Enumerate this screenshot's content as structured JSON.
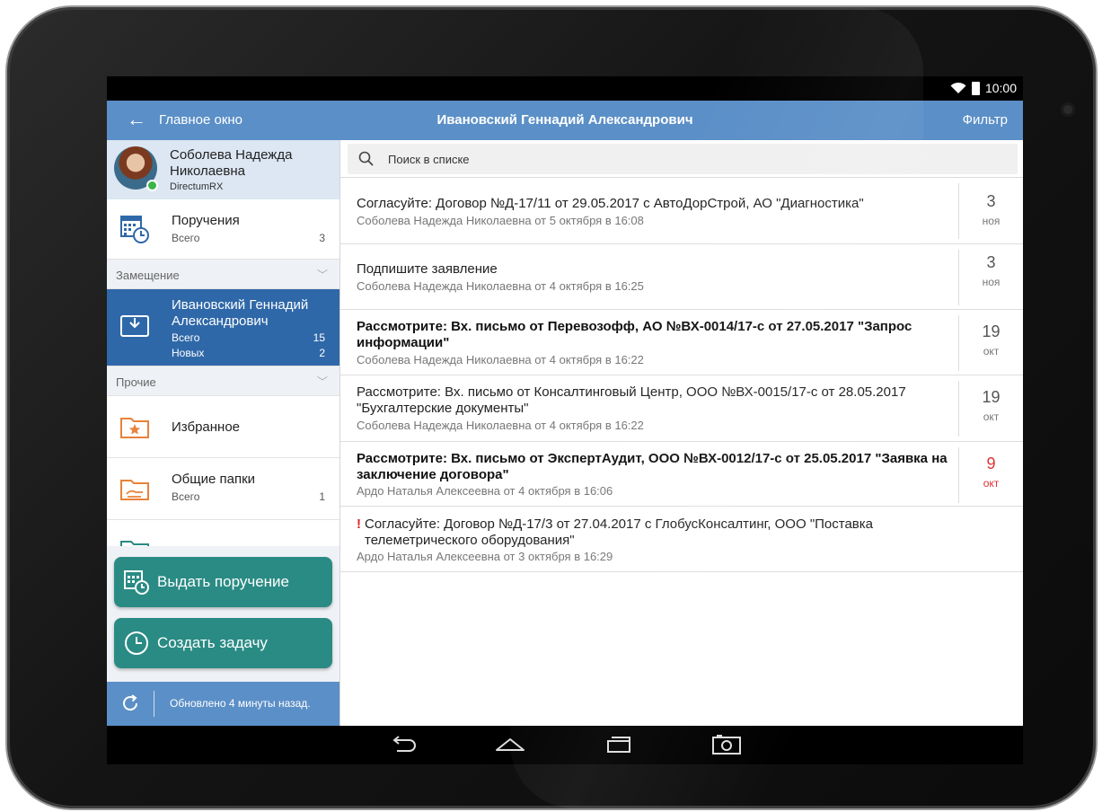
{
  "status_bar": {
    "time": "10:00"
  },
  "app_bar": {
    "back_label": "Главное окно",
    "title": "Ивановский Геннадий Александрович",
    "filter_label": "Фильтр"
  },
  "profile": {
    "name": "Соболева Надежда Николаевна",
    "org": "DirectumRX"
  },
  "sidebar": {
    "assignments": {
      "label": "Поручения",
      "sub": "Всего",
      "count": "3"
    },
    "substitution_section": "Замещение",
    "substitute": {
      "label": "Ивановский Геннадий Александрович",
      "total_label": "Всего",
      "total": "15",
      "new_label": "Новых",
      "new": "2"
    },
    "other_section": "Прочие",
    "favorites": {
      "label": "Избранное"
    },
    "shared_folders": {
      "label": "Общие папки",
      "sub": "Всего",
      "count": "1"
    }
  },
  "actions": {
    "issue_assignment": "Выдать поручение",
    "create_task": "Создать задачу"
  },
  "sync": {
    "text": "Обновлено 4 минуты назад."
  },
  "search": {
    "placeholder": "Поиск в списке"
  },
  "tasks": [
    {
      "title": "Согласуйте: Договор №Д-17/11 от 29.05.2017 с АвтоДорСтрой, АО \"Диагностика\"",
      "meta": "Соболева Надежда Николаевна от 5 октября в 16:08",
      "day": "3",
      "month": "ноя"
    },
    {
      "title": "Подпишите заявление",
      "meta": "Соболева Надежда Николаевна от 4 октября в 16:25",
      "day": "3",
      "month": "ноя"
    },
    {
      "title": "Рассмотрите: Вх. письмо от Перевозофф, АО №ВХ-0014/17-с от 27.05.2017 \"Запрос информации\"",
      "meta": "Соболева Надежда Николаевна от 4 октября в 16:22",
      "day": "19",
      "month": "окт"
    },
    {
      "title": "Рассмотрите: Вх. письмо от Консалтинговый Центр, ООО №ВХ-0015/17-с от 28.05.2017 \"Бухгалтерские документы\"",
      "meta": "Соболева Надежда Николаевна от 4 октября в 16:22",
      "day": "19",
      "month": "окт"
    },
    {
      "title": "Рассмотрите: Вх. письмо от ЭкспертАудит, ООО №ВХ-0012/17-с от 25.05.2017 \"Заявка на заключение договора\"",
      "meta": "Ардо Наталья Алексеевна от 4 октября в 16:06",
      "day": "9",
      "month": "окт"
    },
    {
      "priority": "!",
      "title": "Согласуйте: Договор №Д-17/3 от 27.04.2017 с ГлобусКонсалтинг, ООО \"Поставка телеметрического оборудования\"",
      "meta": "Ардо Наталья Алексеевна от 3 октября в 16:29"
    }
  ],
  "colors": {
    "app_bar": "#5b8fc7",
    "active_item": "#2f68a8",
    "action_button": "#2a8b84",
    "overdue": "#dd3333"
  }
}
